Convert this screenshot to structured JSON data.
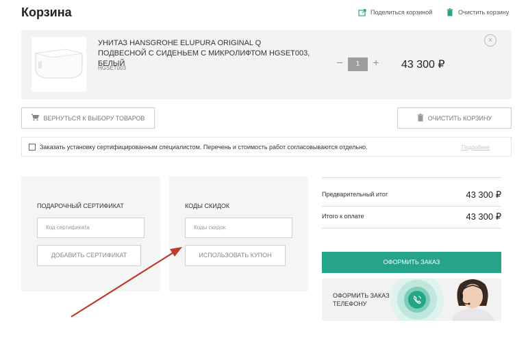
{
  "page": {
    "title": "Корзина"
  },
  "top_actions": {
    "share_label": "Поделиться корзиной",
    "clear_label": "Очистить корзину"
  },
  "cart_item": {
    "name": "УНИТАЗ HANSGROHE ELUPURA ORIGINAL Q ПОДВЕСНОЙ С СИДЕНЬЕМ С МИКРОЛИФТОМ HGSET003, БЕЛЫЙ",
    "sku": "HGSET003",
    "quantity": "1",
    "minus_symbol": "−",
    "plus_symbol": "+",
    "price": "43 300 ₽",
    "remove_symbol": "×"
  },
  "buttons": {
    "back_label": "ВЕРНУТЬСЯ К ВЫБОРУ ТОВАРОВ",
    "clear_label": "ОЧИСТИТЬ КОРЗИНУ"
  },
  "install": {
    "text": "Заказать установку сертифицированным специалистом. Перечень и стоимость работ согласовываются отдельно.",
    "more_label": "Подробнее",
    "checked": false
  },
  "certificate": {
    "title": "ПОДАРОЧНЫЙ СЕРТИФИКАТ",
    "placeholder": "Код сертификата",
    "button_label": "ДОБАВИТЬ СЕРТИФИКАТ"
  },
  "discount": {
    "title": "КОДЫ СКИДОК",
    "placeholder": "Коды скидок",
    "button_label": "ИСПОЛЬЗОВАТЬ КУПОН"
  },
  "summary": {
    "subtotal_label": "Предварительный итог",
    "subtotal_value": "43 300 ₽",
    "total_label": "Итого к оплате",
    "total_value": "43 300 ₽"
  },
  "order": {
    "button_label": "ОФОРМИТЬ ЗАКАЗ"
  },
  "phone_banner": {
    "text": "ОФОРМИТЬ ЗАКАЗ ПО ТЕЛЕФОНУ"
  },
  "icons": {
    "share": "share-icon",
    "trash": "trash-icon",
    "cart": "cart-icon",
    "phone": "phone-icon"
  },
  "colors": {
    "accent": "#25a48a",
    "panel_bg": "#f5f5f5",
    "product_bg": "#f3f3f3",
    "arrow": "#c0392b"
  }
}
